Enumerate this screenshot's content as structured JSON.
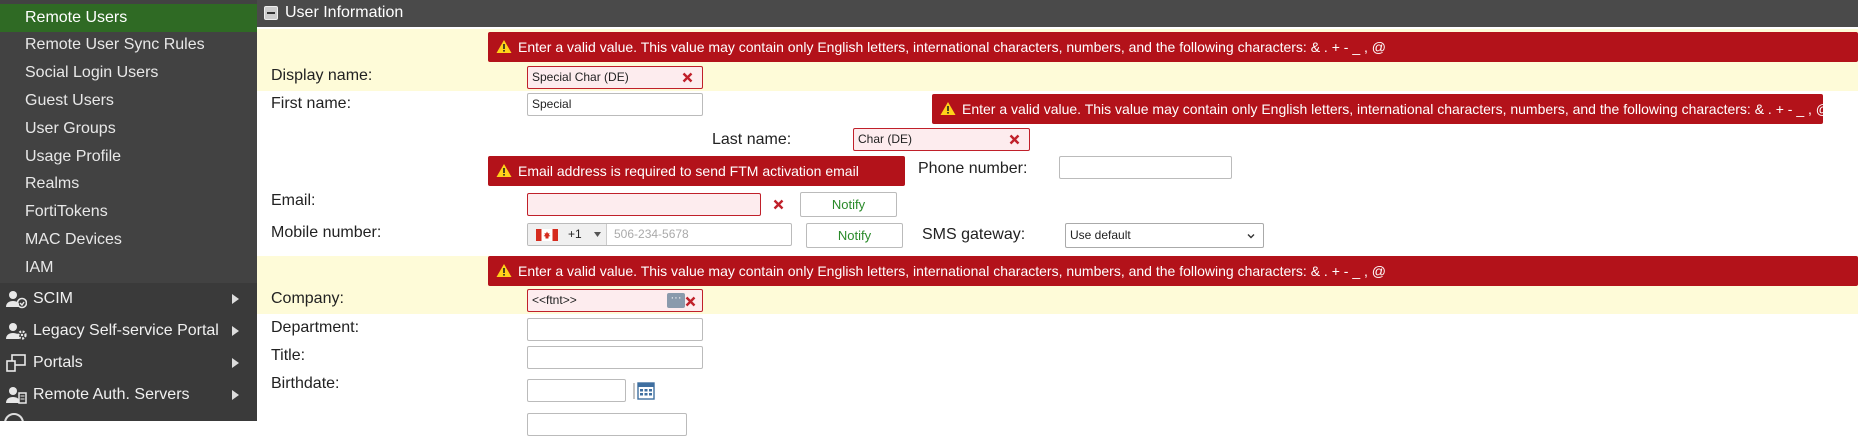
{
  "sidebar": {
    "sub_items": [
      {
        "label": "Remote Users",
        "active": true
      },
      {
        "label": "Remote User Sync Rules"
      },
      {
        "label": "Social Login Users"
      },
      {
        "label": "Guest Users"
      },
      {
        "label": "User Groups"
      },
      {
        "label": "Usage Profile"
      },
      {
        "label": "Realms"
      },
      {
        "label": "FortiTokens"
      },
      {
        "label": "MAC Devices"
      },
      {
        "label": "IAM"
      }
    ],
    "groups": [
      {
        "label": "SCIM",
        "icon": "users-sync-icon"
      },
      {
        "label": "Legacy Self-service Portal",
        "icon": "users-gear-icon"
      },
      {
        "label": "Portals",
        "icon": "portal-icon"
      },
      {
        "label": "Remote Auth. Servers",
        "icon": "server-users-icon"
      }
    ]
  },
  "panel": {
    "title": "User Information"
  },
  "errors": {
    "display_name": "Enter a valid value. This value may contain only English letters, international characters, numbers, and the following characters: & . + - _ , @",
    "last_name": "Enter a valid value. This value may contain only English letters, international characters, numbers, and the following characters: & . + - _ , @",
    "email": "Email address is required to send FTM activation email",
    "company": "Enter a valid value. This value may contain only English letters, international characters, numbers, and the following characters: & . + - _ , @"
  },
  "fields": {
    "display_name": {
      "label": "Display name:",
      "value": "Special Char (DE)"
    },
    "first_name": {
      "label": "First name:",
      "value": "Special"
    },
    "last_name": {
      "label": "Last name:",
      "value": "Char (DE)"
    },
    "phone_number": {
      "label": "Phone number:",
      "value": ""
    },
    "email": {
      "label": "Email:",
      "value": "",
      "notify": "Notify"
    },
    "mobile_number": {
      "label": "Mobile number:",
      "country_code": "+1",
      "placeholder": "506-234-5678",
      "notify": "Notify"
    },
    "sms_gateway": {
      "label": "SMS gateway:",
      "value": "Use default"
    },
    "company": {
      "label": "Company:",
      "value": "<<ftnt>>"
    },
    "department": {
      "label": "Department:",
      "value": ""
    },
    "title": {
      "label": "Title:",
      "value": ""
    },
    "birthdate": {
      "label": "Birthdate:",
      "value": ""
    }
  },
  "colors": {
    "error": "#b3121a",
    "active_nav": "#2f6a24",
    "highlight": "#fefbd8",
    "notify_text": "#2a8a2a"
  }
}
